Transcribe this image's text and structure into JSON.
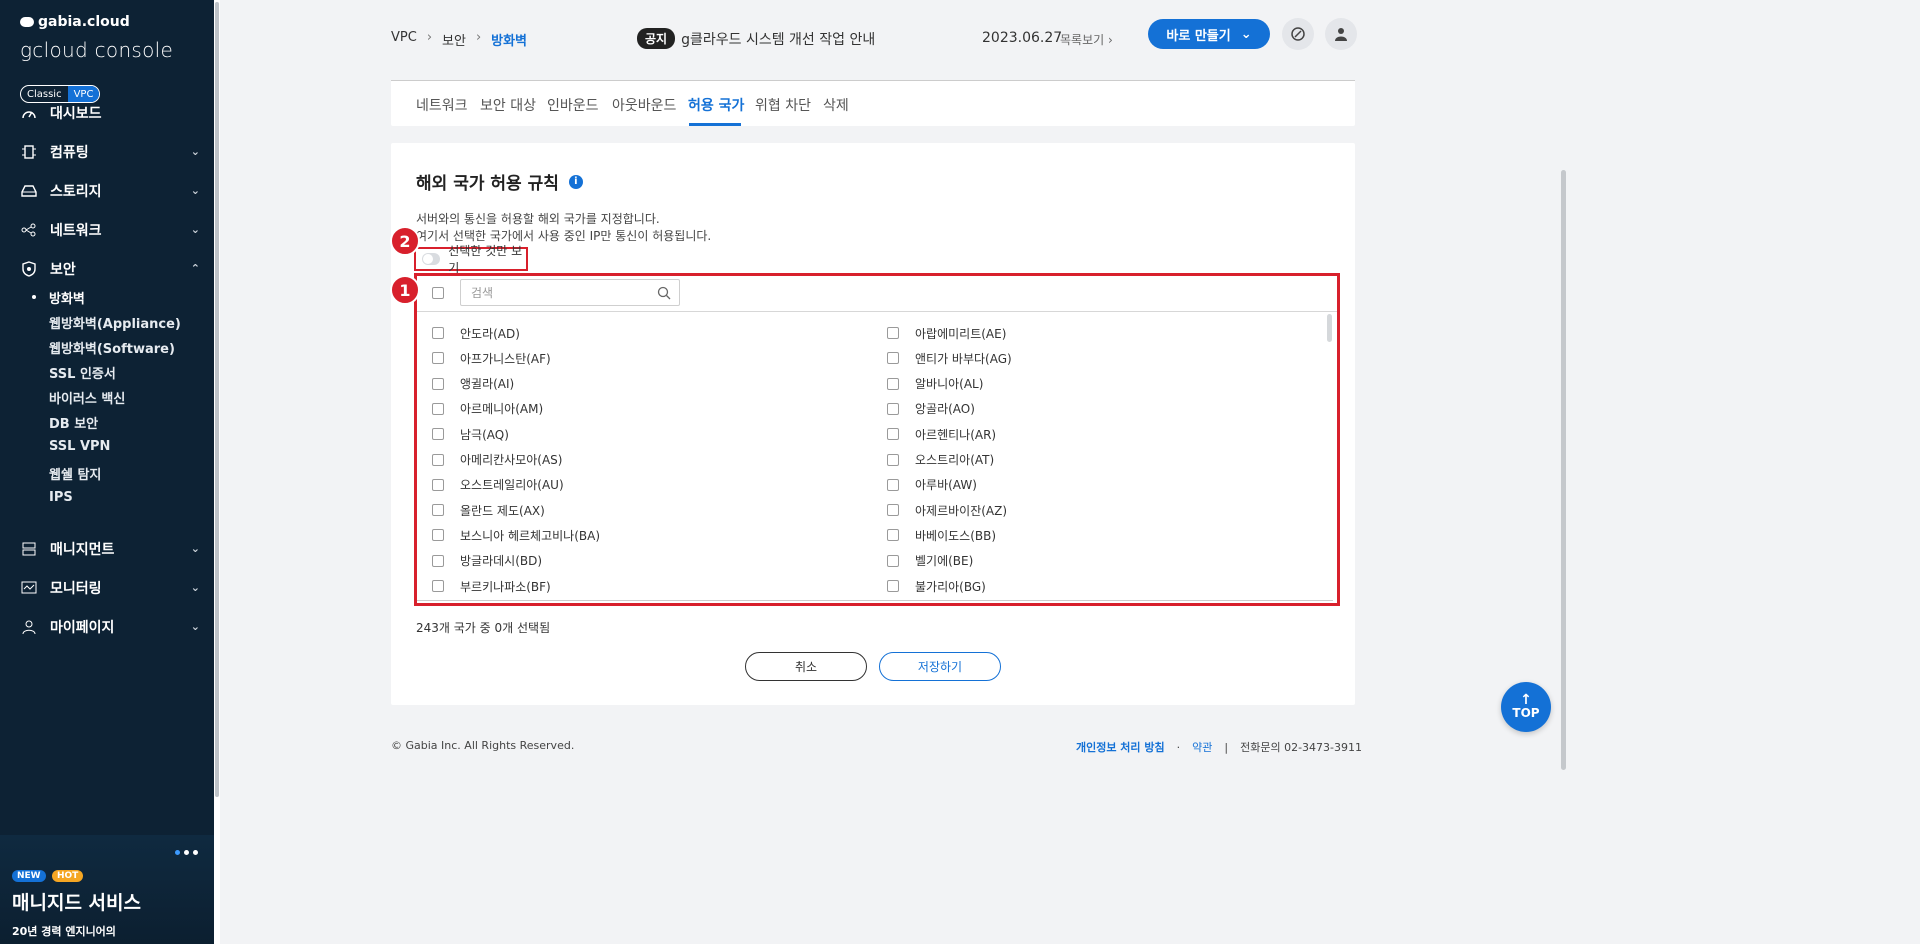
{
  "sidebar": {
    "brand_small": "gabia.cloud",
    "brand_big": "gcloud console",
    "modes": [
      "Classic",
      "VPC"
    ],
    "nav": [
      {
        "label": "대시보드",
        "icon": "dashboard-icon"
      },
      {
        "label": "컴퓨팅",
        "icon": "chip-icon"
      },
      {
        "label": "스토리지",
        "icon": "storage-icon"
      },
      {
        "label": "네트워크",
        "icon": "network-icon"
      },
      {
        "label": "보안",
        "icon": "shield-icon"
      },
      {
        "label": "매니지먼트",
        "icon": "server-icon"
      },
      {
        "label": "모니터링",
        "icon": "monitor-icon"
      },
      {
        "label": "마이페이지",
        "icon": "user-icon"
      }
    ],
    "security_sub": [
      "방화벽",
      "웹방화벽(Appliance)",
      "웹방화벽(Software)",
      "SSL 인증서",
      "바이러스 백신",
      "DB 보안",
      "SSL VPN",
      "웹쉘 탐지",
      "IPS"
    ],
    "promo": {
      "badge_new": "NEW",
      "badge_hot": "HOT",
      "title": "매니지드 서비스",
      "subtitle": "20년 경력 엔지니어의"
    }
  },
  "header": {
    "breadcrumb": [
      "VPC",
      "보안",
      "방화벽"
    ],
    "notice_tag": "공지",
    "notice_text": "g클라우드 시스템 개선 작업 안내",
    "notice_date": "2023.06.27",
    "notice_more": "목록보기",
    "create_button": "바로 만들기"
  },
  "tabs": [
    "네트워크",
    "보안 대상",
    "인바운드",
    "아웃바운드",
    "허용 국가",
    "위협 차단",
    "삭제"
  ],
  "active_tab": "허용 국가",
  "section": {
    "title": "해외 국가 허용 규칙",
    "desc1": "서버와의 통신을 허용할 해외 국가를 지정합니다.",
    "desc2": "여기서 선택한 국가에서 사용 중인 IP만 통신이 허용됩니다.",
    "toggle_label": "선택한 것만 보기",
    "search_placeholder": "검색",
    "markers": [
      "1",
      "2"
    ],
    "countries_left": [
      "안도라(AD)",
      "아프가니스탄(AF)",
      "앵귈라(AI)",
      "아르메니아(AM)",
      "남극(AQ)",
      "아메리칸사모아(AS)",
      "오스트레일리아(AU)",
      "올란드 제도(AX)",
      "보스니아 헤르체고비나(BA)",
      "방글라데시(BD)",
      "부르키나파소(BF)"
    ],
    "countries_right": [
      "아랍에미리트(AE)",
      "앤티가 바부다(AG)",
      "알바니아(AL)",
      "앙골라(AO)",
      "아르헨티나(AR)",
      "오스트리아(AT)",
      "아루바(AW)",
      "아제르바이잔(AZ)",
      "바베이도스(BB)",
      "벨기에(BE)",
      "불가리아(BG)"
    ],
    "count_text": "243개 국가 중 0개 선택됨",
    "cancel_button": "취소",
    "save_button": "저장하기"
  },
  "footer": {
    "copyright": "© Gabia Inc. All Rights Reserved.",
    "privacy": "개인정보 처리 방침",
    "dot": "·",
    "terms": "약관",
    "bar": "|",
    "phone": "전화문의  02-3473-3911"
  },
  "top_button": "TOP",
  "colors": {
    "sidebar_bg": "#0d2234",
    "accent": "#1471d6",
    "highlight": "#d8202c"
  }
}
